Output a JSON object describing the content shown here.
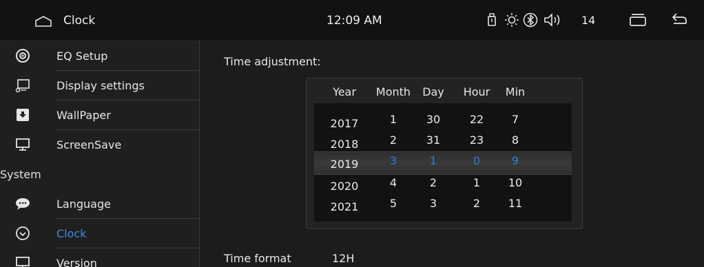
{
  "statusbar": {
    "title": "Clock",
    "time": "12:09 AM",
    "volume": "14",
    "icons": [
      "home-icon",
      "usb-icon",
      "brightness-icon",
      "bluetooth-icon",
      "volume-icon",
      "recent-apps-icon",
      "back-icon"
    ]
  },
  "sidebar": {
    "items": [
      {
        "label": "EQ Setup",
        "icon": "eq-icon"
      },
      {
        "label": "Display settings",
        "icon": "display-icon"
      },
      {
        "label": "WallPaper",
        "icon": "wallpaper-icon"
      },
      {
        "label": "ScreenSave",
        "icon": "screensave-icon"
      },
      {
        "label": "System",
        "header": true
      },
      {
        "label": "Language",
        "icon": "language-icon"
      },
      {
        "label": "Clock",
        "icon": "clock-icon",
        "active": true
      },
      {
        "label": "Version",
        "icon": "version-icon"
      }
    ]
  },
  "main": {
    "time_adjustment_label": "Time adjustment:",
    "columns": [
      "Year",
      "Month",
      "Day",
      "Hour",
      "Min"
    ],
    "year": [
      "2017",
      "2018",
      "2019",
      "2020",
      "2021"
    ],
    "month": [
      "1",
      "2",
      "3",
      "4",
      "5"
    ],
    "day": [
      "30",
      "31",
      "1",
      "2",
      "3"
    ],
    "hour": [
      "22",
      "23",
      "0",
      "1",
      "2"
    ],
    "min": [
      "7",
      "8",
      "9",
      "10",
      "11"
    ],
    "time_format_label": "Time format",
    "time_format_value": "12H"
  },
  "colors": {
    "accent": "#2f7fd8",
    "background": "#1c1c1c",
    "statusbar": "#121212"
  }
}
